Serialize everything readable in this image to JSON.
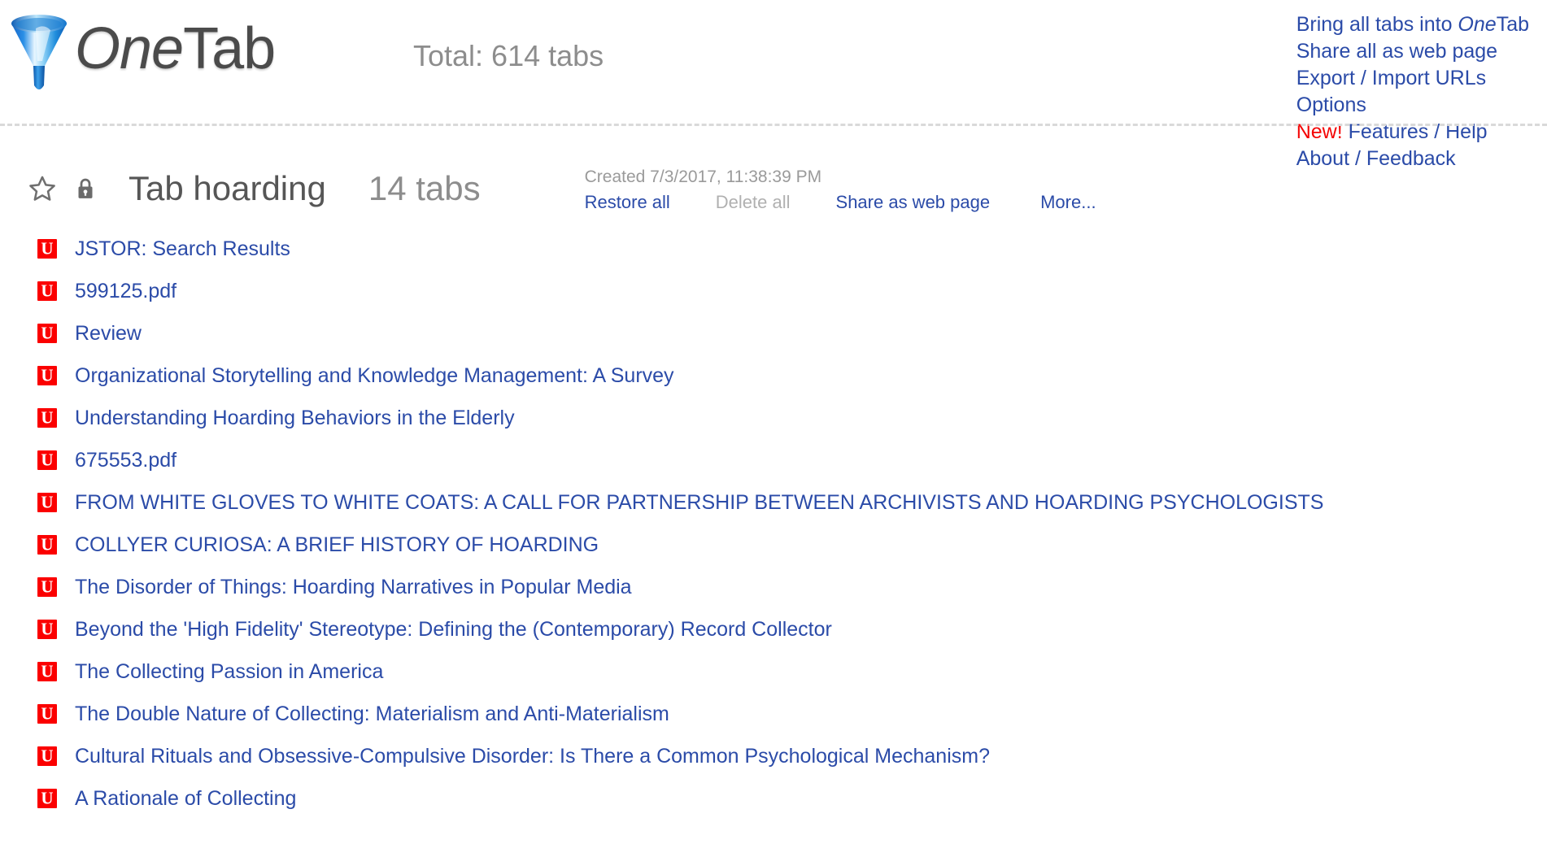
{
  "header": {
    "logo_icon": "funnel-logo-icon",
    "brand_prefix": "One",
    "brand_suffix": "Tab",
    "total_tabs": "Total: 614 tabs"
  },
  "topnav": {
    "items": [
      {
        "label_prefix": "Bring all tabs into ",
        "label_italic": "One",
        "label_suffix": "Tab",
        "name": "bring-all-tabs-into-onetab-link"
      },
      {
        "label": "Share all as web page",
        "name": "share-all-as-web-page-link"
      },
      {
        "label": "Export / Import URLs",
        "name": "export-import-urls-link"
      },
      {
        "label": "Options",
        "name": "options-link"
      },
      {
        "badge": "New!",
        "label": " Features / Help",
        "name": "features-help-link"
      },
      {
        "label": "About / Feedback",
        "name": "about-feedback-link"
      }
    ]
  },
  "group": {
    "star_icon": "star-outline-icon",
    "lock_icon": "lock-icon",
    "title": "Tab hoarding",
    "count": "14 tabs",
    "created": "Created 7/3/2017, 11:38:39 PM",
    "actions": {
      "restore_all": "Restore all",
      "delete_all": "Delete all",
      "share_as_web_page": "Share as web page",
      "more": "More..."
    },
    "tabs": [
      {
        "title": "JSTOR: Search Results",
        "favicon": "red-u-favicon",
        "favicon_letter": "U"
      },
      {
        "title": "599125.pdf",
        "favicon": "red-u-favicon",
        "favicon_letter": "U"
      },
      {
        "title": "Review",
        "favicon": "red-u-favicon",
        "favicon_letter": "U"
      },
      {
        "title": "Organizational Storytelling and Knowledge Management: A Survey",
        "favicon": "red-u-favicon",
        "favicon_letter": "U"
      },
      {
        "title": "Understanding Hoarding Behaviors in the Elderly",
        "favicon": "red-u-favicon",
        "favicon_letter": "U"
      },
      {
        "title": "675553.pdf",
        "favicon": "red-u-favicon",
        "favicon_letter": "U"
      },
      {
        "title": "FROM WHITE GLOVES TO WHITE COATS: A CALL FOR PARTNERSHIP BETWEEN ARCHIVISTS AND HOARDING PSYCHOLOGISTS",
        "favicon": "red-u-favicon",
        "favicon_letter": "U"
      },
      {
        "title": "COLLYER CURIOSA: A BRIEF HISTORY OF HOARDING",
        "favicon": "red-u-favicon",
        "favicon_letter": "U"
      },
      {
        "title": "The Disorder of Things: Hoarding Narratives in Popular Media",
        "favicon": "red-u-favicon",
        "favicon_letter": "U"
      },
      {
        "title": "Beyond the 'High Fidelity' Stereotype: Defining the (Contemporary) Record Collector",
        "favicon": "red-u-favicon",
        "favicon_letter": "U"
      },
      {
        "title": "The Collecting Passion in America",
        "favicon": "red-u-favicon",
        "favicon_letter": "U"
      },
      {
        "title": "The Double Nature of Collecting: Materialism and Anti-Materialism",
        "favicon": "red-u-favicon",
        "favicon_letter": "U"
      },
      {
        "title": "Cultural Rituals and Obsessive-Compulsive Disorder: Is There a Common Psychological Mechanism?",
        "favicon": "red-u-favicon",
        "favicon_letter": "U"
      },
      {
        "title": "A Rationale of Collecting",
        "favicon": "red-u-favicon",
        "favicon_letter": "U"
      }
    ]
  },
  "colors": {
    "link_blue": "#2b4ba8",
    "new_red": "#f40505",
    "favicon_red": "#fb0000",
    "title_gray": "#565656",
    "muted_gray": "#8d8d8d",
    "disabled_gray": "#b0b0b0",
    "divider_gray": "#d9d9d9"
  }
}
